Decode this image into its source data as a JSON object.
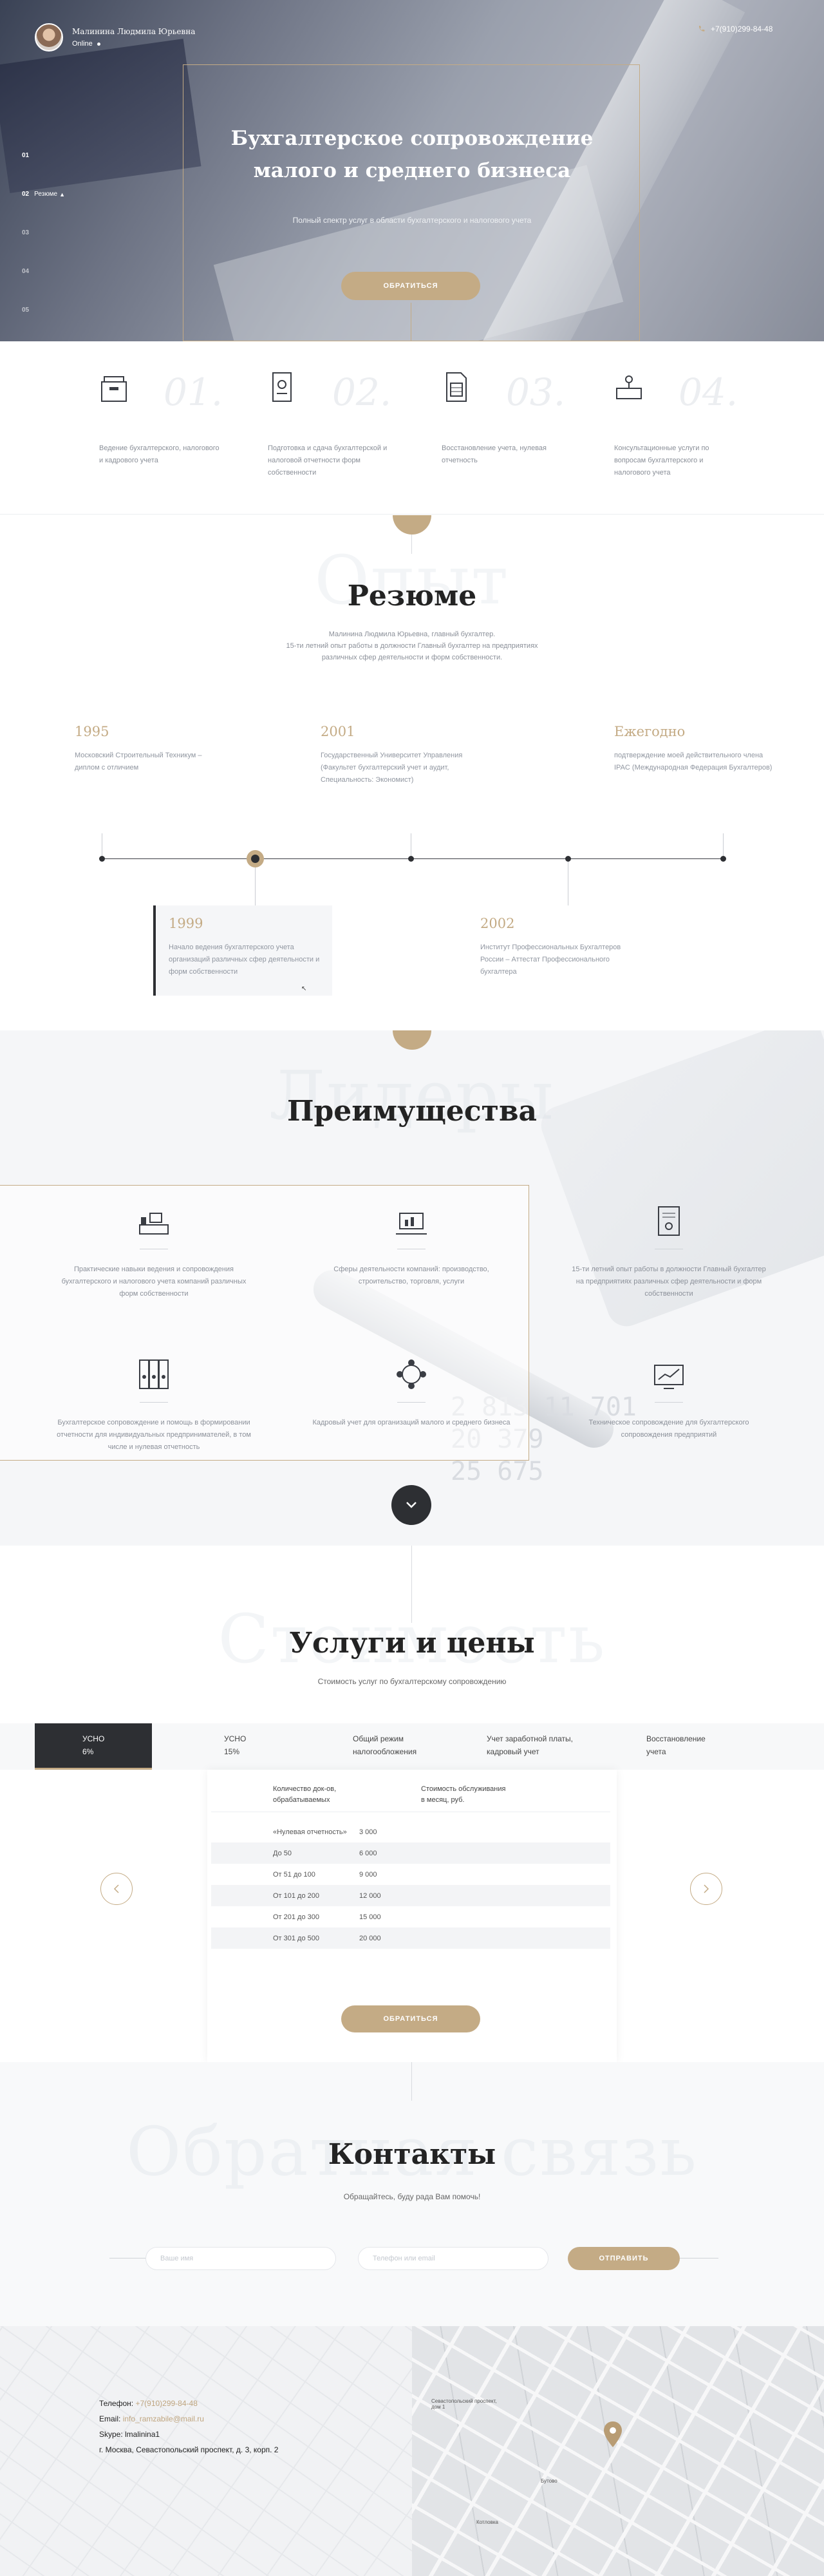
{
  "header": {
    "name": "Малинина Людмила Юрьевна",
    "status": "Online",
    "phone": "+7(910)299-84-48"
  },
  "sidenav": [
    {
      "num": "01",
      "label": ""
    },
    {
      "num": "02",
      "label": "Резюме"
    },
    {
      "num": "03",
      "label": ""
    },
    {
      "num": "04",
      "label": ""
    },
    {
      "num": "05",
      "label": ""
    }
  ],
  "hero": {
    "title_line1": "Бухгалтерское сопровождение",
    "title_line2": "малого и среднего бизнеса",
    "subtitle": "Полный спектр услуг в области бухгалтерского и налогового учета",
    "button": "Обратиться"
  },
  "services": [
    {
      "num": "01.",
      "icon": "archive-box-icon",
      "text": "Ведение бухгалтерского, налогового и кадрового учета"
    },
    {
      "num": "02.",
      "icon": "report-document-icon",
      "text": "Подготовка и сдача бухгалтерской и налоговой отчетности форм собственности"
    },
    {
      "num": "03.",
      "icon": "calculator-document-icon",
      "text": "Восстановление учета, нулевая отчетность"
    },
    {
      "num": "04.",
      "icon": "consultation-desk-icon",
      "text": "Консультационные услуги по вопросам бухгалтерского и налогового учета"
    }
  ],
  "resume": {
    "bg_word": "Опыт",
    "title": "Резюме",
    "intro_line1": "Малинина Людмила Юрьевна, главный бухгалтер.",
    "intro_line2": "15-ти летний опыт работы в должности Главный бухгалтер на предприятиях",
    "intro_line3": "различных сфер деятельности и форм собственности.",
    "top": [
      {
        "year": "1995",
        "text": "Московский Строительный Техникум – диплом с отличием"
      },
      {
        "year": "2001",
        "text": "Государственный Университет Управления (Факультет бухгалтерский учет и аудит, Специальность: Экономист)"
      },
      {
        "year": "Ежегодно",
        "text": "подтверждение моей действительного члена IPAC (Международная Федерация Бухгалтеров)"
      }
    ],
    "bottom": [
      {
        "year": "1999",
        "text": "Начало ведения бухгалтерского учета организаций различных сфер деятельности и форм собственности"
      },
      {
        "year": "2002",
        "text": "Институт Профессиональных Бухгалтеров России – Аттестат Профессионального бухгалтера"
      }
    ]
  },
  "advantages": {
    "bg_word": "Лидеры",
    "title": "Преимущества",
    "items": [
      {
        "icon": "office-desk-icon",
        "text": "Практические навыки ведения и сопровождения бухгалтерского и налогового учета компаний различных форм собственности"
      },
      {
        "icon": "presentation-icon",
        "text": "Сферы деятельности компаний: производство, строительство, торговля, услуги"
      },
      {
        "icon": "certificate-icon",
        "text": "15-ти летний опыт работы в должности Главный бухгалтер на предприятиях различных сфер деятельности и форм собственности"
      },
      {
        "icon": "binders-icon",
        "text": "Бухгалтерское сопровождение и помощь в формировании отчетности для индивидуальных предпринимателей, в том числе и нулевая отчетность"
      },
      {
        "icon": "people-network-icon",
        "text": "Кадровый учет для организаций малого и среднего бизнеса"
      },
      {
        "icon": "monitor-chart-icon",
        "text": "Техническое сопровождение для бухгалтерского сопровождения предприятий"
      }
    ]
  },
  "prices": {
    "bg_word": "Стоимость",
    "title": "Услуги и цены",
    "subtitle": "Стоимость услуг по бухгалтерскому сопровождению",
    "tabs": [
      {
        "line1": "УСНО",
        "line2": "6%"
      },
      {
        "line1": "УСНО",
        "line2": "15%"
      },
      {
        "line1": "Общий режим",
        "line2": "налогообложения"
      },
      {
        "line1": "Учет заработной платы,",
        "line2": "кадровый учет"
      },
      {
        "line1": "Восстановление",
        "line2": "учета"
      }
    ],
    "col1_line1": "Количество док-ов,",
    "col1_line2": "обрабатываемых",
    "col2_line1": "Стоимость обслуживания",
    "col2_line2": "в месяц, руб.",
    "rows": [
      {
        "qty": "«Нулевая отчетность»",
        "price": "3 000"
      },
      {
        "qty": "До 50",
        "price": "6 000"
      },
      {
        "qty": "От 51 до 100",
        "price": "9 000"
      },
      {
        "qty": "От 101 до 200",
        "price": "12 000"
      },
      {
        "qty": "От 201 до 300",
        "price": "15 000"
      },
      {
        "qty": "От 301 до 500",
        "price": "20 000"
      }
    ],
    "button": "Обратиться"
  },
  "contacts": {
    "bg_word": "Обратная связь",
    "title": "Контакты",
    "subtitle": "Обращайтесь, буду рада Вам помочь!",
    "name_placeholder": "Ваше имя",
    "contact_placeholder": "Телефон или email",
    "button": "Отправить",
    "phone_label": "Телефон:",
    "phone": "+7(910)299-84-48",
    "email_label": "Email:",
    "email": "info_ramzabile@mail.ru",
    "skype": "Skype: lmalinina1",
    "address": "г. Москва, Севастопольский проспект, д. 3, корп. 2",
    "map_label1": "Севастопольский проспект, дом 1",
    "map_label2": "Бутово",
    "map_label3": "Котловка"
  },
  "colors": {
    "accent": "#c4ab85",
    "dark": "#2d2f33"
  }
}
